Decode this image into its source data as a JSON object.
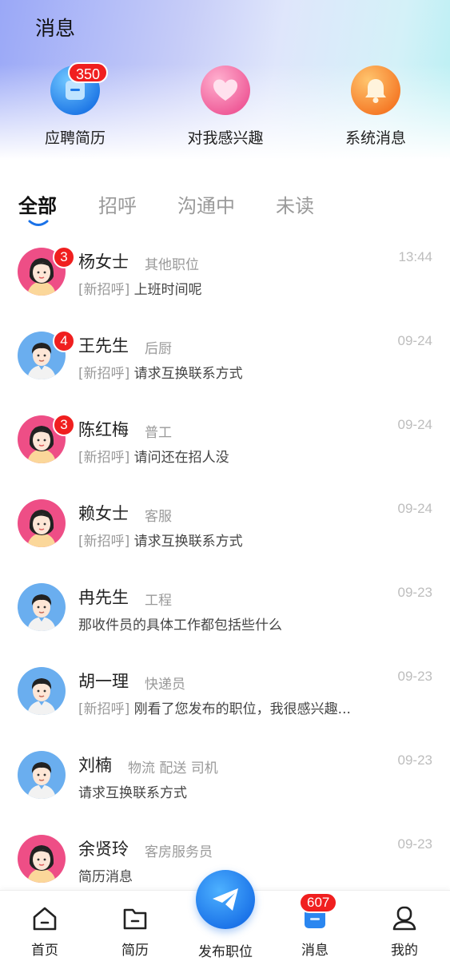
{
  "header": {
    "title": "消息"
  },
  "quick_actions": [
    {
      "label": "应聘简历",
      "icon": "resume-icon",
      "badge": "350",
      "color": "#1f78e6"
    },
    {
      "label": "对我感兴趣",
      "icon": "heart-icon",
      "badge": "",
      "color": "#ef5b98"
    },
    {
      "label": "系统消息",
      "icon": "bell-icon",
      "badge": "",
      "color": "#f57a27"
    }
  ],
  "tabs": [
    {
      "label": "全部",
      "active": true
    },
    {
      "label": "招呼",
      "active": false
    },
    {
      "label": "沟通中",
      "active": false
    },
    {
      "label": "未读",
      "active": false
    }
  ],
  "messages": [
    {
      "name": "杨女士",
      "tag": "其他职位",
      "time": "13:44",
      "prefix": "[新招呼]",
      "text": "上班时间呢",
      "badge": "3",
      "gender": "female"
    },
    {
      "name": "王先生",
      "tag": "后厨",
      "time": "09-24",
      "prefix": "[新招呼]",
      "text": "请求互换联系方式",
      "badge": "4",
      "gender": "male"
    },
    {
      "name": "陈红梅",
      "tag": "普工",
      "time": "09-24",
      "prefix": "[新招呼]",
      "text": "请问还在招人没",
      "badge": "3",
      "gender": "female"
    },
    {
      "name": "赖女士",
      "tag": "客服",
      "time": "09-24",
      "prefix": "[新招呼]",
      "text": "请求互换联系方式",
      "badge": "",
      "gender": "female"
    },
    {
      "name": "冉先生",
      "tag": "工程",
      "time": "09-23",
      "prefix": "",
      "text": "那收件员的具体工作都包括些什么",
      "badge": "",
      "gender": "male"
    },
    {
      "name": "胡一理",
      "tag": "快递员",
      "time": "09-23",
      "prefix": "[新招呼]",
      "text": "刚看了您发布的职位，我很感兴趣...",
      "badge": "",
      "gender": "male"
    },
    {
      "name": "刘楠",
      "tag": "物流 配送 司机",
      "time": "09-23",
      "prefix": "",
      "text": "请求互换联系方式",
      "badge": "",
      "gender": "male"
    },
    {
      "name": "余贤玲",
      "tag": "客房服务员",
      "time": "09-23",
      "prefix": "",
      "text": "简历消息",
      "badge": "",
      "gender": "female"
    }
  ],
  "bottom_nav": {
    "home": "首页",
    "resume": "简历",
    "publish": "发布职位",
    "messages": "消息",
    "messages_badge": "607",
    "mine": "我的"
  }
}
